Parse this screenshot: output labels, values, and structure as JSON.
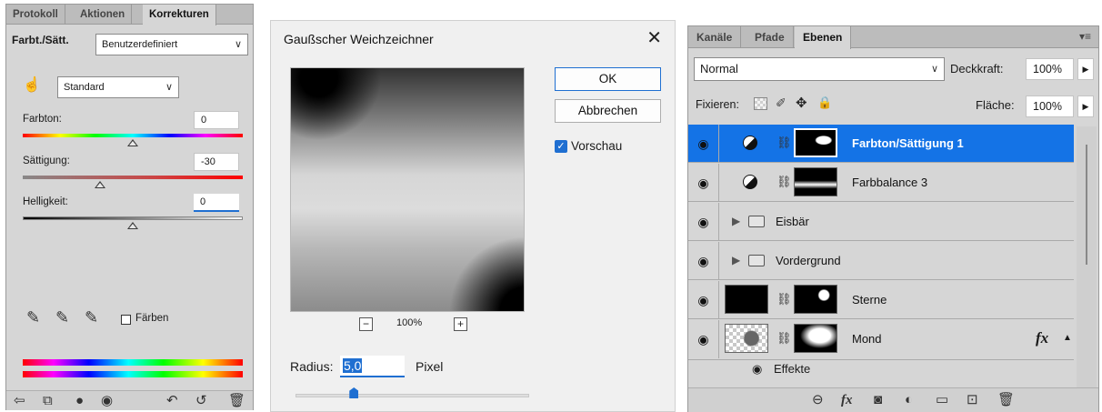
{
  "korrekturen": {
    "tabs": [
      "Protokoll",
      "Aktionen",
      "Korrekturen"
    ],
    "preset_label": "Farbt./Sätt.",
    "preset_value": "Benutzerdefiniert",
    "channel_value": "Standard",
    "farbton_label": "Farbton:",
    "farbton_value": "0",
    "farbton_fraction": 0.5,
    "saettigung_label": "Sättigung:",
    "saettigung_value": "-30",
    "saettigung_fraction": 0.35,
    "helligkeit_label": "Helligkeit:",
    "helligkeit_value": "0",
    "helligkeit_fraction": 0.5,
    "faerben_label": "Färben",
    "faerben_checked": false
  },
  "gauss": {
    "title": "Gaußscher Weichzeichner",
    "close_glyph": "✕",
    "ok_label": "OK",
    "cancel_label": "Abbrechen",
    "preview_label": "Vorschau",
    "preview_checked": true,
    "zoom_minus": "−",
    "zoom_plus": "+",
    "zoom_value": "100%",
    "radius_label": "Radius:",
    "radius_value": "5,0",
    "radius_unit": "Pixel",
    "radius_fraction": 0.25
  },
  "ebenen": {
    "tabs": [
      "Kanäle",
      "Pfade",
      "Ebenen"
    ],
    "menu_glyph": "▾≡",
    "blend_mode": "Normal",
    "opacity_label": "Deckkraft:",
    "opacity_value": "100%",
    "lock_label": "Fixieren:",
    "fill_label": "Fläche:",
    "fill_value": "100%",
    "layers": [
      {
        "name": "Farbton/Sättigung 1",
        "kind": "adjustment",
        "selected": true
      },
      {
        "name": "Farbbalance 3",
        "kind": "adjustment",
        "selected": false
      },
      {
        "name": "Eisbär",
        "kind": "group",
        "selected": false
      },
      {
        "name": "Vordergrund",
        "kind": "group",
        "selected": false
      },
      {
        "name": "Sterne",
        "kind": "masked",
        "selected": false
      },
      {
        "name": "Mond",
        "kind": "masked-fx",
        "selected": false
      }
    ],
    "fx_badge": "fx",
    "effects_label": "Effekte"
  },
  "colors": {
    "accent": "#1473e6",
    "panel_bg": "#d6d6d6",
    "dialog_bg": "#f0f0f0"
  }
}
